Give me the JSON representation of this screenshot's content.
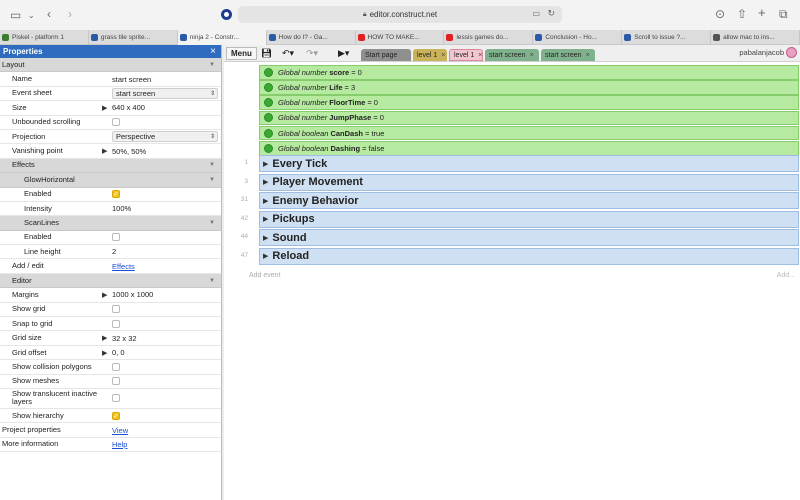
{
  "browser": {
    "url": "editor.construct.net",
    "tabs": [
      {
        "label": "Piskel - platform 1",
        "color": "#3a7d2f"
      },
      {
        "label": "grass tile sprite...",
        "color": "#2b5aa8"
      },
      {
        "label": "ninja 2 - Constr...",
        "color": "#2b5aa8",
        "active": true
      },
      {
        "label": "How do I? - Ga...",
        "color": "#2b5aa8"
      },
      {
        "label": "HOW TO MAKE...",
        "color": "#e02020"
      },
      {
        "label": "lessis games do...",
        "color": "#e02020"
      },
      {
        "label": "Conclusion - Ho...",
        "color": "#2b5aa8"
      },
      {
        "label": "Scroll to issue ?...",
        "color": "#2b5aa8"
      },
      {
        "label": "allow mac to ins...",
        "color": "#555555"
      }
    ]
  },
  "properties": {
    "title": "Properties",
    "rows": [
      {
        "type": "cat",
        "label": "Layout",
        "level": "top"
      },
      {
        "label": "Name",
        "value": "start screen",
        "kind": "text"
      },
      {
        "label": "Event sheet",
        "value": "start screen",
        "kind": "select"
      },
      {
        "label": "Size",
        "value": "640 x 400",
        "kind": "text",
        "tri": true
      },
      {
        "label": "Unbounded scrolling",
        "kind": "check",
        "checked": false
      },
      {
        "label": "Projection",
        "value": "Perspective",
        "kind": "select"
      },
      {
        "label": "Vanishing point",
        "value": "50%, 50%",
        "kind": "text",
        "tri": true
      },
      {
        "type": "cat",
        "label": "Effects"
      },
      {
        "type": "cat",
        "label": "GlowHorizontal",
        "sub": true
      },
      {
        "label": "Enabled",
        "kind": "check",
        "checked": true,
        "sub": true
      },
      {
        "label": "Intensity",
        "value": "100%",
        "kind": "text",
        "sub": true
      },
      {
        "type": "cat",
        "label": "ScanLines",
        "sub": true
      },
      {
        "label": "Enabled",
        "kind": "check",
        "checked": false,
        "sub": true
      },
      {
        "label": "Line height",
        "value": "2",
        "kind": "text",
        "sub": true
      },
      {
        "label": "Add / edit",
        "value": "Effects",
        "kind": "link"
      },
      {
        "type": "cat",
        "label": "Editor"
      },
      {
        "label": "Margins",
        "value": "1000 x 1000",
        "kind": "text",
        "tri": true
      },
      {
        "label": "Show grid",
        "kind": "check",
        "checked": false
      },
      {
        "label": "Snap to grid",
        "kind": "check",
        "checked": false
      },
      {
        "label": "Grid size",
        "value": "32 x 32",
        "kind": "text",
        "tri": true
      },
      {
        "label": "Grid offset",
        "value": "0, 0",
        "kind": "text",
        "tri": true
      },
      {
        "label": "Show collision polygons",
        "kind": "check",
        "checked": false
      },
      {
        "label": "Show meshes",
        "kind": "check",
        "checked": false
      },
      {
        "label": "Show translucent inactive layers",
        "kind": "check",
        "checked": false,
        "tall": true
      },
      {
        "label": "Show hierarchy",
        "kind": "check",
        "checked": true
      },
      {
        "label": "Project properties",
        "value": "View",
        "kind": "link",
        "level": "top"
      },
      {
        "label": "More information",
        "value": "Help",
        "kind": "link",
        "level": "top"
      }
    ]
  },
  "editor": {
    "menu_label": "Menu",
    "user": "pabalanjacob",
    "tabs": [
      {
        "label": "Start page",
        "bg": "#8f8f8f"
      },
      {
        "label": "level 1",
        "bg": "#c9b35a"
      },
      {
        "label": "level 1",
        "bg": "#f2c6cf",
        "active": true
      },
      {
        "label": "start screen",
        "bg": "#7fb28c"
      },
      {
        "label": "start screen",
        "bg": "#7fb28c"
      }
    ],
    "globals": [
      {
        "kind": "Global number",
        "name": "score",
        "value": "= 0"
      },
      {
        "kind": "Global number",
        "name": "Life",
        "value": "= 3"
      },
      {
        "kind": "Global number",
        "name": "FloorTime",
        "value": "= 0"
      },
      {
        "kind": "Global number",
        "name": "JumpPhase",
        "value": "= 0"
      },
      {
        "kind": "Global boolean",
        "name": "CanDash",
        "value": "= true"
      },
      {
        "kind": "Global boolean",
        "name": "Dashing",
        "value": "= false"
      }
    ],
    "groups": [
      {
        "num": "1",
        "label": "Every Tick"
      },
      {
        "num": "3",
        "label": "Player Movement"
      },
      {
        "num": "31",
        "label": "Enemy Behavior"
      },
      {
        "num": "42",
        "label": "Pickups"
      },
      {
        "num": "44",
        "label": "Sound"
      },
      {
        "num": "47",
        "label": "Reload"
      }
    ],
    "add_event": "Add event",
    "add_right": "Add..."
  }
}
